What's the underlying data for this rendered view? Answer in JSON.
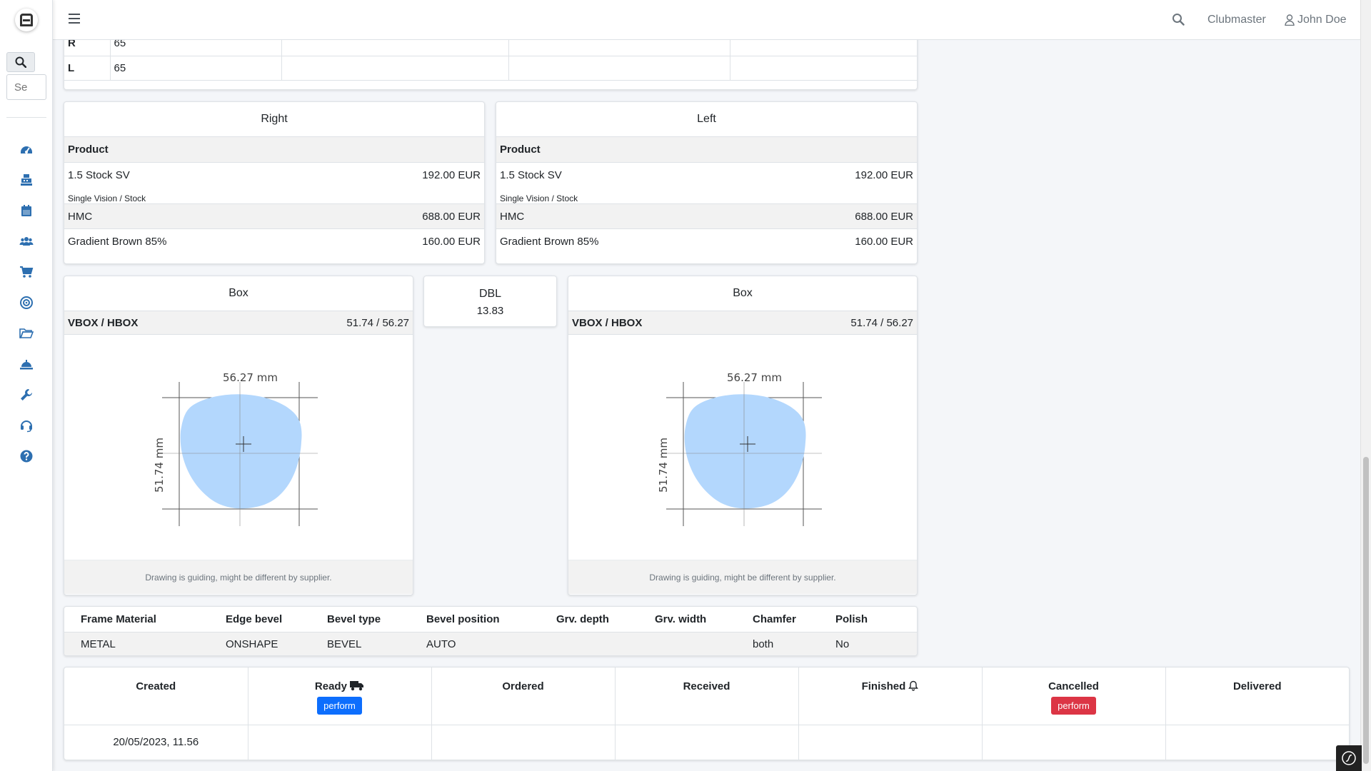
{
  "sidebar": {
    "search_placeholder": "Se",
    "nav_icons": [
      "dashboard-icon",
      "cash-register-icon",
      "calendar-icon",
      "users-icon",
      "cart-icon",
      "target-icon",
      "folder-open-icon",
      "bell-concierge-icon",
      "wrench-icon",
      "headset-icon",
      "question-icon"
    ]
  },
  "topbar": {
    "club": "Clubmaster",
    "user": "John Doe"
  },
  "top_table": {
    "rows": [
      {
        "label": "R",
        "value": "65"
      },
      {
        "label": "L",
        "value": "65"
      }
    ]
  },
  "lenses": {
    "right": {
      "title": "Right",
      "product_header": "Product",
      "product_name": "1.5 Stock SV",
      "product_price": "192.00 EUR",
      "product_sub": "Single Vision / Stock",
      "coating_name": "HMC",
      "coating_price": "688.00 EUR",
      "tint_name": "Gradient Brown 85%",
      "tint_price": "160.00 EUR"
    },
    "left": {
      "title": "Left",
      "product_header": "Product",
      "product_name": "1.5 Stock SV",
      "product_price": "192.00 EUR",
      "product_sub": "Single Vision / Stock",
      "coating_name": "HMC",
      "coating_price": "688.00 EUR",
      "tint_name": "Gradient Brown 85%",
      "tint_price": "160.00 EUR"
    }
  },
  "box": {
    "right": {
      "title": "Box",
      "label": "VBOX / HBOX",
      "value": "51.74 / 56.27",
      "width_label": "56.27 mm",
      "height_label": "51.74 mm",
      "footer": "Drawing is guiding, might be different by supplier."
    },
    "left": {
      "title": "Box",
      "label": "VBOX / HBOX",
      "value": "51.74 / 56.27",
      "width_label": "56.27 mm",
      "height_label": "51.74 mm",
      "footer": "Drawing is guiding, might be different by supplier."
    },
    "dbl": {
      "label": "DBL",
      "value": "13.83"
    }
  },
  "material": {
    "headers": [
      "Frame Material",
      "Edge bevel",
      "Bevel type",
      "Bevel position",
      "Grv. depth",
      "Grv. width",
      "Chamfer",
      "Polish"
    ],
    "values": [
      "METAL",
      "ONSHAPE",
      "BEVEL",
      "AUTO",
      "",
      "",
      "both",
      "No"
    ]
  },
  "status": {
    "headers": [
      "Created",
      "Ready",
      "Ordered",
      "Received",
      "Finished",
      "Cancelled",
      "Delivered"
    ],
    "perform_label": "perform",
    "created_date": "20/05/2023, 11.56",
    "colors": {
      "primary": "#0d6efd",
      "danger": "#dc3545"
    }
  },
  "colors": {
    "lens_fill": "#b3d7fd",
    "accent": "#2d6fb0"
  }
}
